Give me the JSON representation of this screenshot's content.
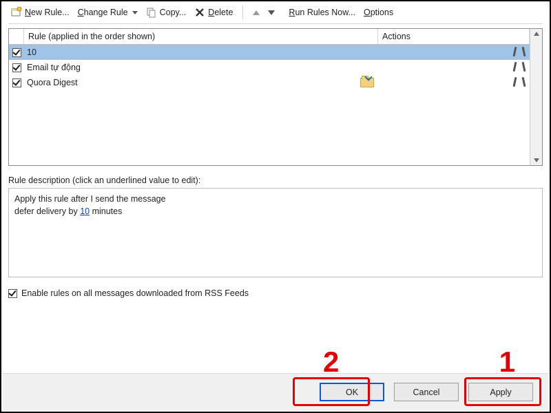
{
  "toolbar": {
    "new_rule": "New Rule...",
    "change_rule": "Change Rule",
    "copy": "Copy...",
    "delete": "Delete",
    "run_rules_now": "Run Rules Now...",
    "options": "Options"
  },
  "list": {
    "col_rule": "Rule (applied in the order shown)",
    "col_actions": "Actions",
    "rows": [
      {
        "checked": true,
        "name": "10",
        "selected": true,
        "icons": [
          "tool"
        ]
      },
      {
        "checked": true,
        "name": "Email tự động",
        "selected": false,
        "icons": [
          "tool"
        ]
      },
      {
        "checked": true,
        "name": "Quora Digest",
        "selected": false,
        "icons": [
          "folder",
          "tool"
        ]
      }
    ]
  },
  "description": {
    "label": "Rule description (click an underlined value to edit):",
    "line1": "Apply this rule after I send the message",
    "line2a": "defer delivery by ",
    "line2_link": "10",
    "line2b": " minutes"
  },
  "rss": {
    "label": "Enable rules on all messages downloaded from RSS Feeds",
    "checked": true
  },
  "buttons": {
    "ok": "OK",
    "cancel": "Cancel",
    "apply": "Apply"
  },
  "callouts": {
    "one": "1",
    "two": "2"
  }
}
